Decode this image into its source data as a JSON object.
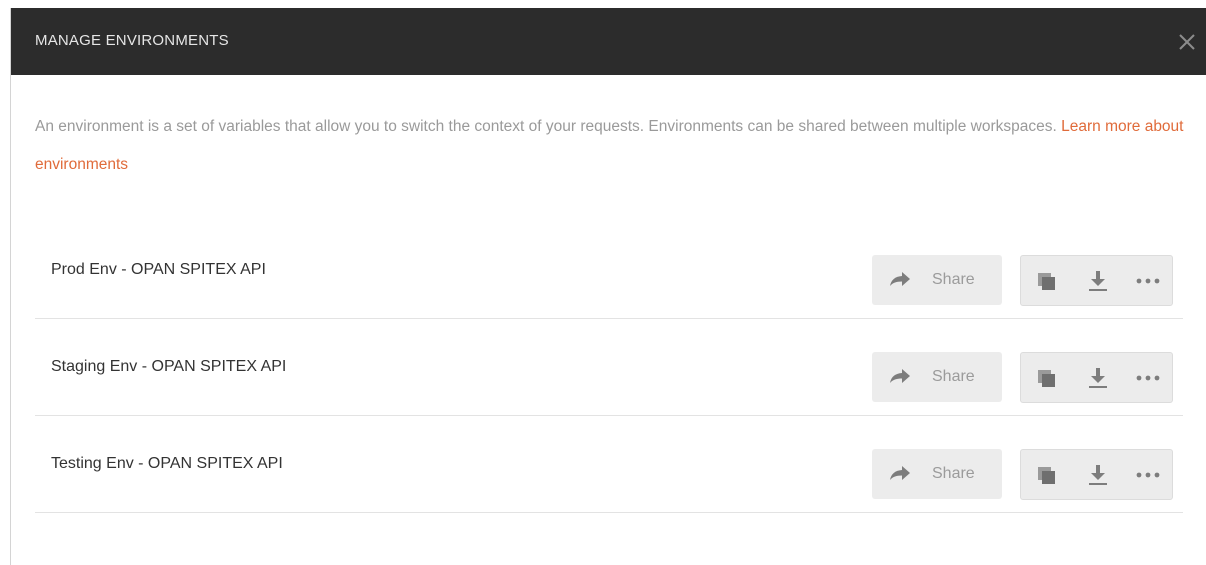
{
  "header": {
    "title": "MANAGE ENVIRONMENTS",
    "close_icon": "close-icon"
  },
  "intro": {
    "text": "An environment is a set of variables that allow you to switch the context of your requests. Environments can be shared between multiple workspaces. ",
    "link_label": "Learn more about environments"
  },
  "environments": [
    {
      "name": "Prod Env - OPAN SPITEX API",
      "share_label": "Share"
    },
    {
      "name": "Staging Env - OPAN SPITEX API",
      "share_label": "Share"
    },
    {
      "name": "Testing Env - OPAN SPITEX API",
      "share_label": "Share"
    }
  ],
  "actions": {
    "icons": [
      "share-arrow-icon",
      "duplicate-icon",
      "download-icon",
      "more-options-icon"
    ]
  },
  "colors": {
    "header_bg": "#2c2c2c",
    "link": "#e06b3a",
    "button_bg": "#ececec",
    "muted_text": "#9a9a9a"
  }
}
